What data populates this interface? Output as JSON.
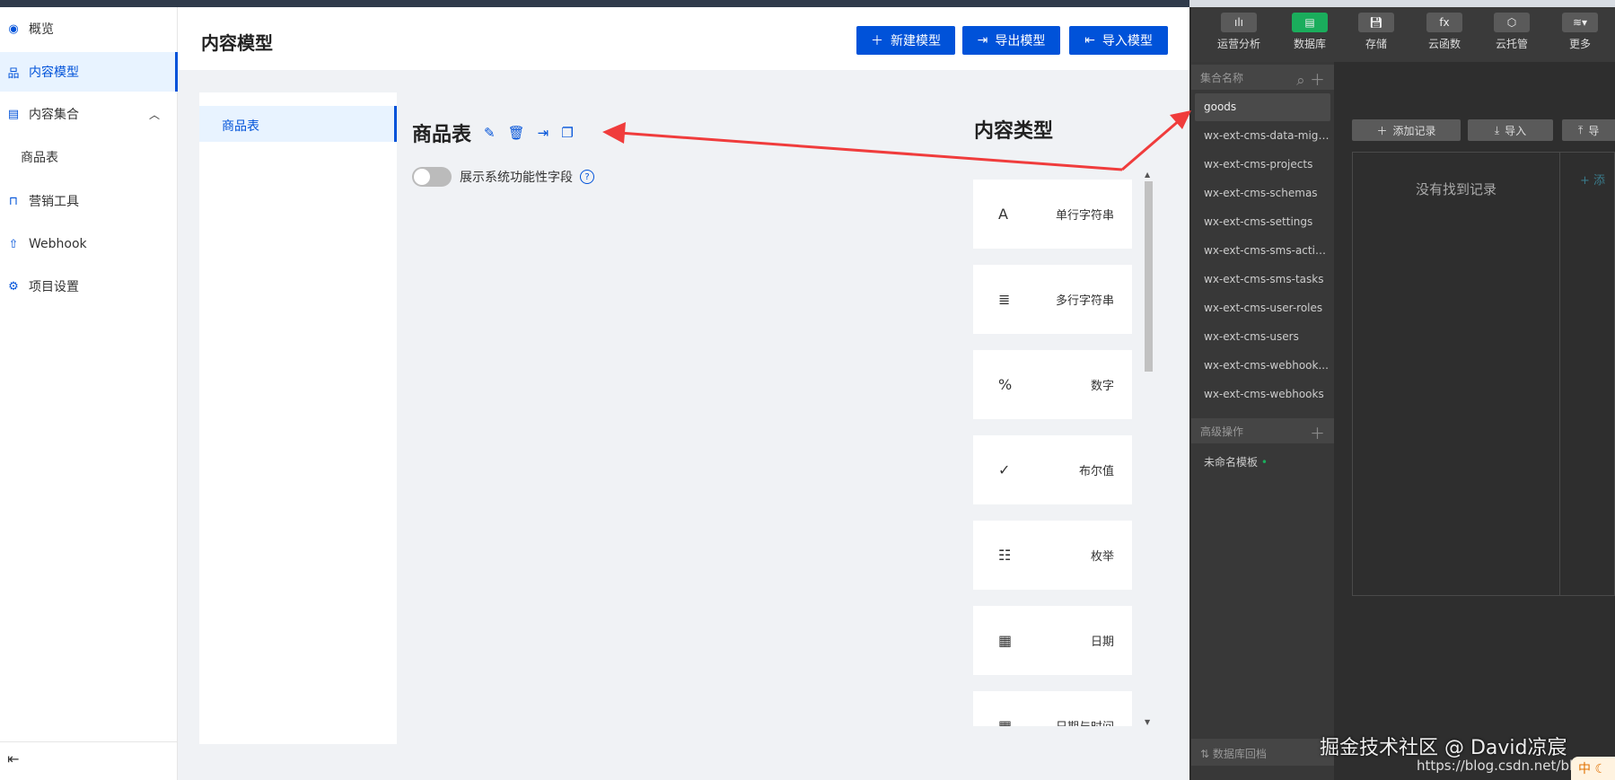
{
  "sidebar": {
    "items": [
      {
        "label": "概览",
        "icon": "eye-icon"
      },
      {
        "label": "内容模型",
        "icon": "sitemap-icon",
        "active": true
      },
      {
        "label": "内容集合",
        "icon": "table-icon",
        "expanded": true
      },
      {
        "label": "商品表",
        "sub": true
      },
      {
        "label": "营销工具",
        "icon": "bag-icon"
      },
      {
        "label": "Webhook",
        "icon": "rocket-icon"
      },
      {
        "label": "项目设置",
        "icon": "gear-icon"
      }
    ]
  },
  "header": {
    "title": "内容模型",
    "buttons": {
      "new": "新建模型",
      "export": "导出模型",
      "import": "导入模型"
    }
  },
  "models": {
    "selected": "商品表"
  },
  "model": {
    "title": "商品表",
    "toggle_label": "展示系统功能性字段",
    "toggle_on": false
  },
  "content_types": {
    "title": "内容类型",
    "items": [
      {
        "label": "单行字符串",
        "icon": "A"
      },
      {
        "label": "多行字符串",
        "icon": "≣"
      },
      {
        "label": "数字",
        "icon": "%"
      },
      {
        "label": "布尔值",
        "icon": "✓"
      },
      {
        "label": "枚举",
        "icon": "☷"
      },
      {
        "label": "日期",
        "icon": "▦"
      },
      {
        "label": "日期与时间",
        "icon": "▦"
      }
    ]
  },
  "devtools": {
    "toolbar": [
      "运营分析",
      "数据库",
      "存储",
      "云函数",
      "云托管",
      "更多"
    ],
    "collections_header": "集合名称",
    "collections": [
      "goods",
      "wx-ext-cms-data-migr...",
      "wx-ext-cms-projects",
      "wx-ext-cms-schemas",
      "wx-ext-cms-settings",
      "wx-ext-cms-sms-activi...",
      "wx-ext-cms-sms-tasks",
      "wx-ext-cms-user-roles",
      "wx-ext-cms-users",
      "wx-ext-cms-webhook...",
      "wx-ext-cms-webhooks"
    ],
    "advanced_header": "高级操作",
    "template": "未命名模板",
    "rollback": "数据库回档",
    "buttons": {
      "add": "添加记录",
      "import": "导入",
      "export": "导"
    },
    "empty": "没有找到记录",
    "add_field": "+ 添"
  },
  "watermark": {
    "line1": "掘金技术社区 @ David凉宸",
    "line2": "https://blog.csdn.net/blue_",
    "ime": "中"
  },
  "colors": {
    "primary": "#0052d9",
    "arrow": "#f03c3c",
    "db_active": "#1aad5c"
  }
}
